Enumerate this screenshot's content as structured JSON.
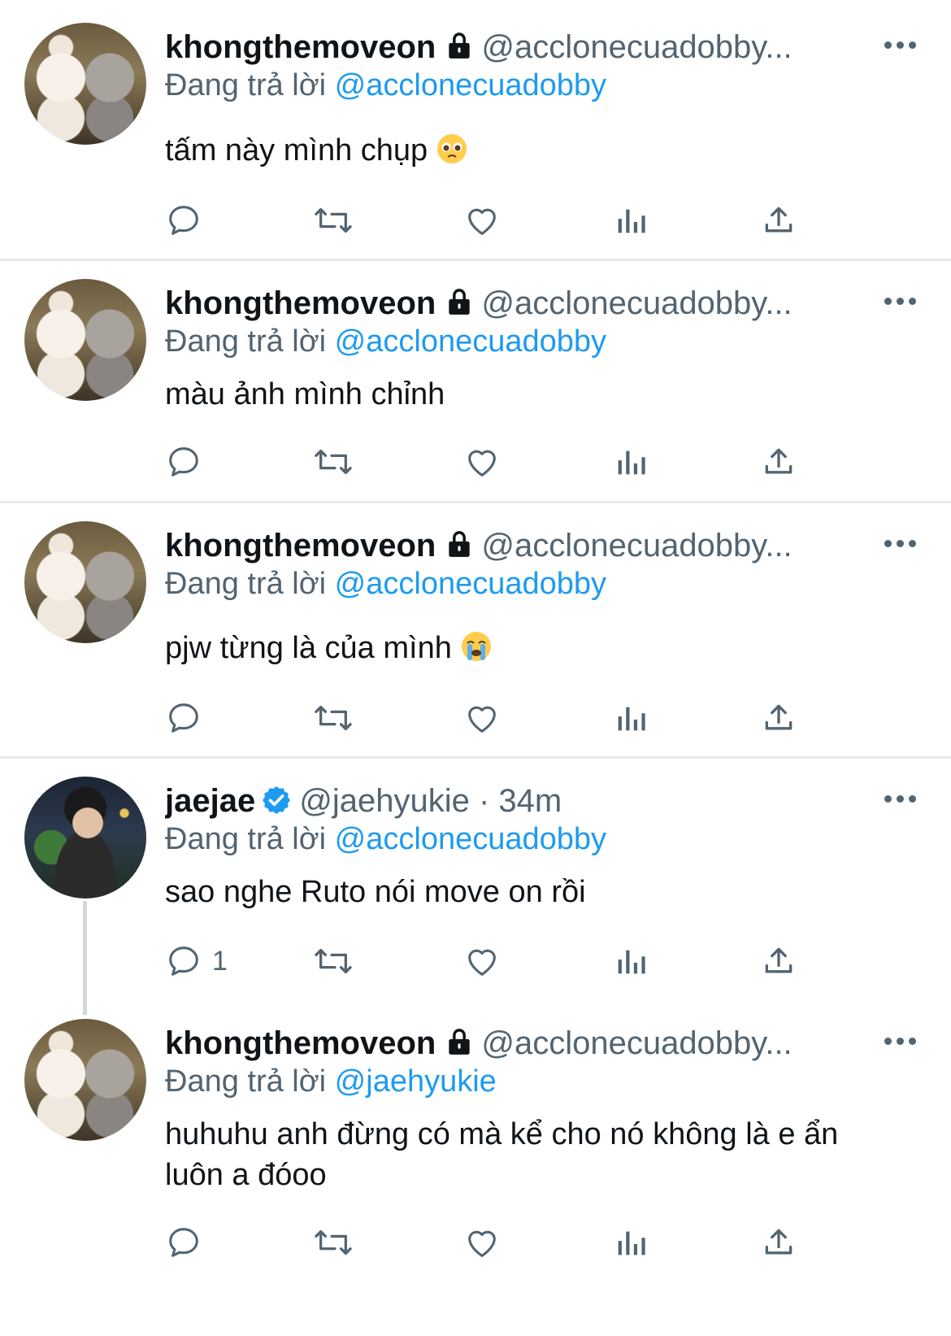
{
  "tweets": [
    {
      "name": "khongthemoveon",
      "handle": "@acclonecuadobby...",
      "reply_prefix": "Đang trả lời",
      "reply_to": "@acclonecuadobby",
      "text": "tấm này mình chụp",
      "emoji": "pleading-face",
      "reply_count": ""
    },
    {
      "name": "khongthemoveon",
      "handle": "@acclonecuadobby...",
      "reply_prefix": "Đang trả lời",
      "reply_to": "@acclonecuadobby",
      "text": "màu ảnh mình chỉnh",
      "emoji": "",
      "reply_count": ""
    },
    {
      "name": "khongthemoveon",
      "handle": "@acclonecuadobby...",
      "reply_prefix": "Đang trả lời",
      "reply_to": "@acclonecuadobby",
      "text": "pjw từng là của mình",
      "emoji": "loudly-crying-face",
      "reply_count": ""
    },
    {
      "name": "jaejae",
      "handle": "@jaehyukie · 34m",
      "reply_prefix": "Đang trả lời",
      "reply_to": "@acclonecuadobby",
      "text": "sao nghe Ruto nói move on rồi",
      "emoji": "",
      "reply_count": "1"
    },
    {
      "name": "khongthemoveon",
      "handle": "@acclonecuadobby...",
      "reply_prefix": "Đang trả lời",
      "reply_to": "@jaehyukie",
      "text": "huhuhu anh đừng có mà kể cho nó không là e ẩn luôn a đóoo",
      "emoji": "",
      "reply_count": ""
    }
  ],
  "colors": {
    "text": "#0f1419",
    "secondary": "#536471",
    "link": "#1d9bf0",
    "divider": "#e7e9ea"
  },
  "icons": [
    "lock-icon",
    "verified-icon",
    "more-icon",
    "reply-icon",
    "retweet-icon",
    "like-icon",
    "views-icon",
    "share-icon"
  ]
}
